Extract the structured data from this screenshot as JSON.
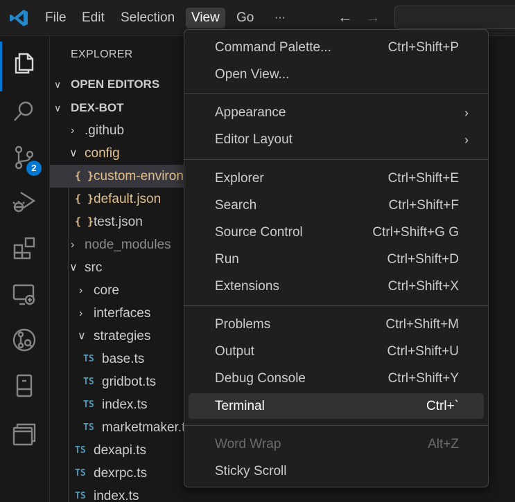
{
  "menubar": {
    "items": [
      "File",
      "Edit",
      "Selection",
      "View",
      "Go"
    ],
    "more": "···",
    "back_arrow": "←",
    "forward_arrow": "→"
  },
  "activity_bar": {
    "icons": [
      "explorer-icon",
      "search-icon",
      "source-control-icon",
      "run-debug-icon",
      "extensions-icon",
      "remote-explorer-icon",
      "gitlens-icon",
      "testing-icon",
      "panel-icon"
    ],
    "source_control_badge": "2",
    "accent": "#0078d4"
  },
  "explorer": {
    "title": "EXPLORER",
    "open_editors": "OPEN EDITORS",
    "project": "DEX-BOT",
    "tree": [
      {
        "label": ".github",
        "kind": "folder-collapsed"
      },
      {
        "label": "config",
        "kind": "folder-expanded"
      },
      {
        "label": "custom-environment-variables.json",
        "kind": "json"
      },
      {
        "label": "default.json",
        "kind": "json"
      },
      {
        "label": "test.json",
        "kind": "json"
      },
      {
        "label": "node_modules",
        "kind": "folder-collapsed"
      },
      {
        "label": "src",
        "kind": "folder-expanded"
      },
      {
        "label": "core",
        "kind": "folder-collapsed"
      },
      {
        "label": "interfaces",
        "kind": "folder-collapsed"
      },
      {
        "label": "strategies",
        "kind": "folder-expanded"
      },
      {
        "label": "base.ts",
        "kind": "ts"
      },
      {
        "label": "gridbot.ts",
        "kind": "ts"
      },
      {
        "label": "index.ts",
        "kind": "ts"
      },
      {
        "label": "marketmaker.ts",
        "kind": "ts"
      },
      {
        "label": "dexapi.ts",
        "kind": "ts"
      },
      {
        "label": "dexrpc.ts",
        "kind": "ts"
      },
      {
        "label": "index.ts",
        "kind": "ts"
      }
    ],
    "json_icon": "{ }",
    "ts_icon": "TS"
  },
  "view_menu": {
    "groups": [
      [
        {
          "label": "Command Palette...",
          "shortcut": "Ctrl+Shift+P"
        },
        {
          "label": "Open View...",
          "shortcut": ""
        }
      ],
      [
        {
          "label": "Appearance",
          "submenu": "›"
        },
        {
          "label": "Editor Layout",
          "submenu": "›"
        }
      ],
      [
        {
          "label": "Explorer",
          "shortcut": "Ctrl+Shift+E"
        },
        {
          "label": "Search",
          "shortcut": "Ctrl+Shift+F"
        },
        {
          "label": "Source Control",
          "shortcut": "Ctrl+Shift+G G"
        },
        {
          "label": "Run",
          "shortcut": "Ctrl+Shift+D"
        },
        {
          "label": "Extensions",
          "shortcut": "Ctrl+Shift+X"
        }
      ],
      [
        {
          "label": "Problems",
          "shortcut": "Ctrl+Shift+M"
        },
        {
          "label": "Output",
          "shortcut": "Ctrl+Shift+U"
        },
        {
          "label": "Debug Console",
          "shortcut": "Ctrl+Shift+Y"
        },
        {
          "label": "Terminal",
          "shortcut": "Ctrl+`"
        }
      ],
      [
        {
          "label": "Word Wrap",
          "shortcut": "Alt+Z"
        },
        {
          "label": "Sticky Scroll",
          "shortcut": ""
        }
      ]
    ]
  }
}
